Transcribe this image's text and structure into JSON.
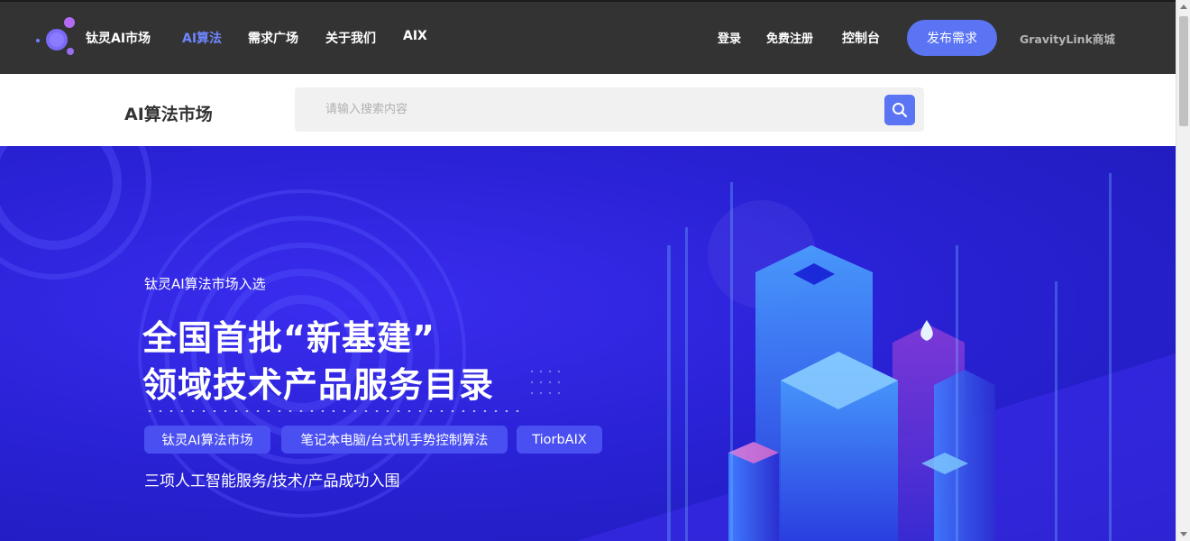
{
  "nav": {
    "brand": "钛灵AI市场",
    "items": [
      {
        "label": "AI算法",
        "active": true
      },
      {
        "label": "需求广场",
        "active": false
      },
      {
        "label": "关于我们",
        "active": false
      },
      {
        "label": "AIX",
        "active": false
      }
    ],
    "login": "登录",
    "register": "免费注册",
    "console": "控制台",
    "publish": "发布需求",
    "store_link": "GravityLink商城"
  },
  "search": {
    "page_title": "AI算法市场",
    "placeholder": "请输入搜索内容"
  },
  "banner": {
    "kicker": "钛灵AI算法市场入选",
    "headline_line1": "全国首批“新基建”",
    "headline_line2": "领域技术产品服务目录",
    "tags": [
      "钛灵AI算法市场",
      "笔记本电脑/台式机手势控制算法",
      "TiorbAIX"
    ],
    "subline": "三项人工智能服务/技术/产品成功入围"
  },
  "colors": {
    "nav_bg": "#333333",
    "accent": "#5a74f3",
    "active_nav": "#6e86ff",
    "banner_bg": "#2a22d6"
  },
  "icons": [
    "logo-orbs-icon",
    "search-icon"
  ]
}
